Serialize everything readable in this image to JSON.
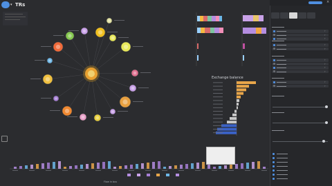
{
  "app": {
    "title": "TRs",
    "brand_color": "#4f8fe0"
  },
  "info_box": {
    "lines": [
      "",
      "",
      ""
    ]
  },
  "network": {
    "center": {
      "label": ""
    },
    "nodes": [
      {
        "label": "",
        "color": "#a77fd6"
      },
      {
        "label": "",
        "color": "#f0c020"
      },
      {
        "label": "",
        "color": "#e8e85a"
      },
      {
        "label": "",
        "color": "#f06a3a"
      },
      {
        "label": "",
        "color": "#86c850"
      },
      {
        "label": "",
        "color": "#e8d040"
      },
      {
        "label": "",
        "color": "#c8a0e8"
      },
      {
        "label": "",
        "color": "#e07090"
      },
      {
        "label": "",
        "color": "#f08830"
      },
      {
        "label": "",
        "color": "#c050a0"
      }
    ]
  },
  "stacked_bars": {
    "title": "",
    "categories": [
      "",
      "",
      "",
      "",
      ""
    ]
  },
  "side_bars": {
    "title": ""
  },
  "exchange_chart": {
    "title": "Exchange balance"
  },
  "timeline": {
    "ylabel": "",
    "xlabel": "Flow in bus"
  },
  "tooltip": {
    "lines": [
      "",
      "",
      "",
      ""
    ]
  },
  "sidebar": {
    "header": "",
    "sections": [
      {
        "title": "",
        "items": [
          "",
          "",
          ""
        ]
      },
      {
        "title": "",
        "items": [
          "",
          ""
        ]
      },
      {
        "title": "",
        "items": [
          "",
          "",
          "",
          ""
        ]
      },
      {
        "title": "",
        "items": [
          "",
          ""
        ]
      },
      {
        "title": "",
        "items": []
      },
      {
        "title": "",
        "items": []
      },
      {
        "title": "",
        "items": []
      }
    ],
    "tabs": [
      "",
      "",
      "",
      "",
      ""
    ],
    "bottom_items": [
      "",
      "",
      "",
      "",
      "",
      "",
      ""
    ]
  },
  "colors": {
    "accent_orange": "#e8a64a",
    "accent_blue": "#3a62c8",
    "gray_bar": "#c9c9c9"
  }
}
